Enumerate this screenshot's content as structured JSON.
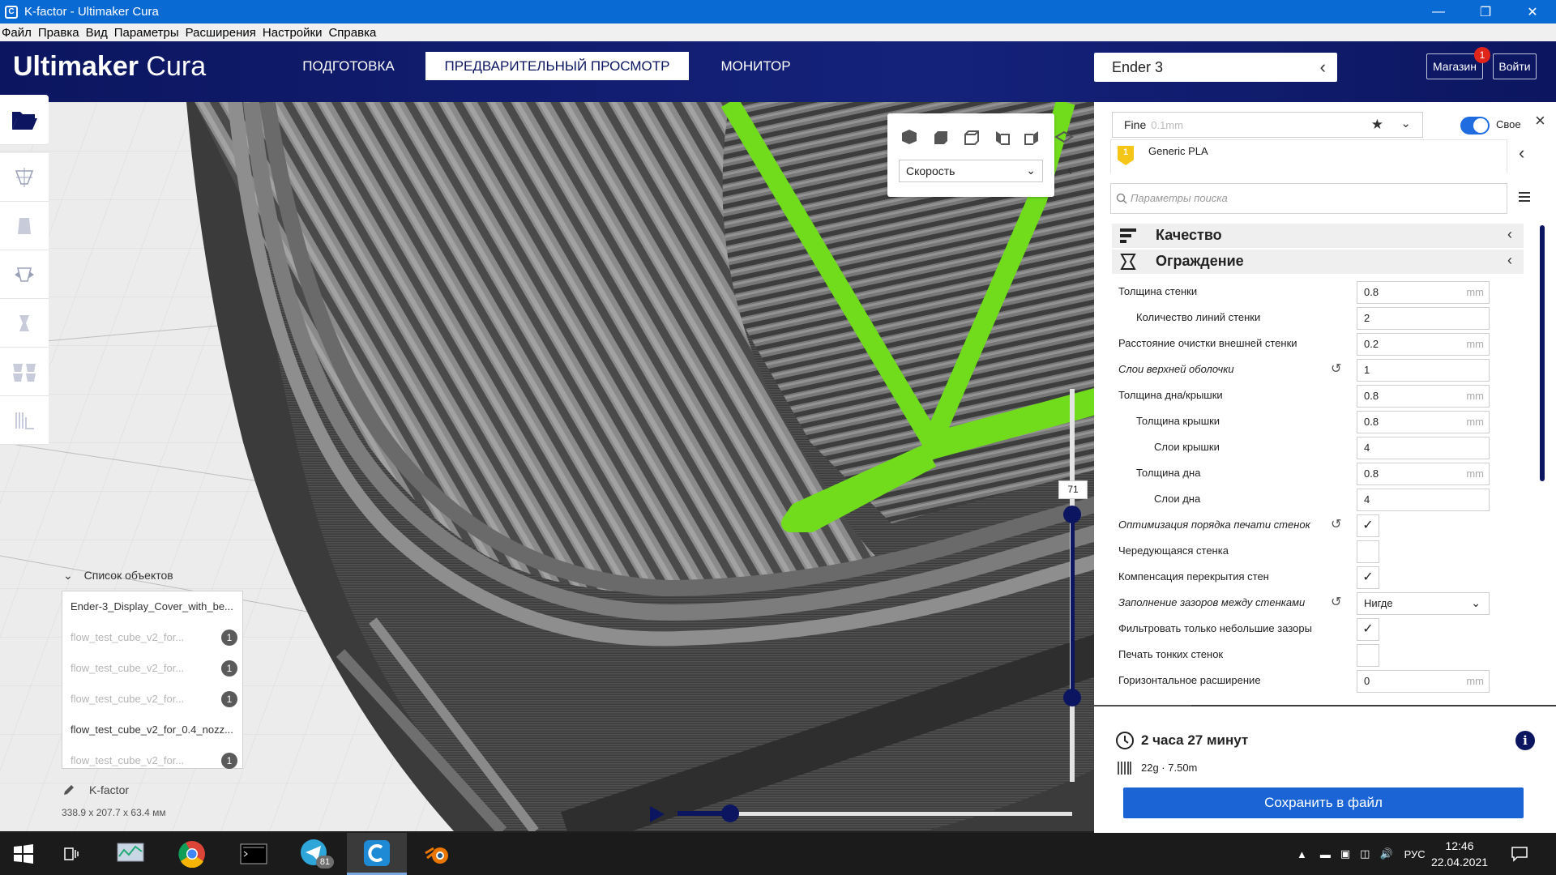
{
  "window": {
    "title": "K-factor - Ultimaker Cura",
    "app_icon": "C"
  },
  "menu": [
    "Файл",
    "Правка",
    "Вид",
    "Параметры",
    "Расширения",
    "Настройки",
    "Справка"
  ],
  "header": {
    "logo_bold": "Ultimaker",
    "logo_light": "Cura",
    "tabs": [
      {
        "label": "ПОДГОТОВКА",
        "active": false
      },
      {
        "label": "ПРЕДВАРИТЕЛЬНЫЙ ПРОСМОТР",
        "active": true
      },
      {
        "label": "МОНИТОР",
        "active": false
      }
    ],
    "printer": "Ender 3",
    "marketplace": "Магазин",
    "marketplace_badge": "1",
    "signin": "Войти"
  },
  "view_panel": {
    "color_scheme": "Скорость"
  },
  "layer_slider": {
    "current_layer": "71"
  },
  "object_list": {
    "header": "Список объектов",
    "items": [
      {
        "name": "Ender-3_Display_Cover_with_be...",
        "dim": false,
        "extruder": ""
      },
      {
        "name": "flow_test_cube_v2_for...",
        "dim": true,
        "extruder": "1"
      },
      {
        "name": "flow_test_cube_v2_for...",
        "dim": true,
        "extruder": "1"
      },
      {
        "name": "flow_test_cube_v2_for...",
        "dim": true,
        "extruder": "1"
      },
      {
        "name": "flow_test_cube_v2_for_0.4_nozz...",
        "dim": false,
        "extruder": ""
      },
      {
        "name": "flow_test_cube_v2_for...",
        "dim": true,
        "extruder": "1"
      }
    ],
    "selected_name": "K-factor",
    "dimensions": "338.9 x 207.7 x 63.4 мм"
  },
  "print_settings": {
    "profile": "Fine",
    "profile_layer": "0.1mm",
    "custom_label": "Свое",
    "material_index": "1",
    "material": "Generic PLA",
    "search_placeholder": "Параметры поиска",
    "categories": {
      "quality": "Качество",
      "shell": "Ограждение"
    },
    "settings": [
      {
        "label": "Толщина стенки",
        "value": "0.8",
        "unit": "mm",
        "indent": 0,
        "italic": false,
        "reset": false,
        "type": "number"
      },
      {
        "label": "Количество линий стенки",
        "value": "2",
        "unit": "",
        "indent": 1,
        "italic": false,
        "reset": false,
        "type": "number"
      },
      {
        "label": "Расстояние очистки внешней стенки",
        "value": "0.2",
        "unit": "mm",
        "indent": 0,
        "italic": false,
        "reset": false,
        "type": "number"
      },
      {
        "label": "Слои верхней оболочки",
        "value": "1",
        "unit": "",
        "indent": 0,
        "italic": true,
        "reset": true,
        "type": "number"
      },
      {
        "label": "Толщина дна/крышки",
        "value": "0.8",
        "unit": "mm",
        "indent": 0,
        "italic": false,
        "reset": false,
        "type": "number"
      },
      {
        "label": "Толщина крышки",
        "value": "0.8",
        "unit": "mm",
        "indent": 1,
        "italic": false,
        "reset": false,
        "type": "number"
      },
      {
        "label": "Слои крышки",
        "value": "4",
        "unit": "",
        "indent": 2,
        "italic": false,
        "reset": false,
        "type": "number"
      },
      {
        "label": "Толщина дна",
        "value": "0.8",
        "unit": "mm",
        "indent": 1,
        "italic": false,
        "reset": false,
        "type": "number"
      },
      {
        "label": "Слои дна",
        "value": "4",
        "unit": "",
        "indent": 2,
        "italic": false,
        "reset": false,
        "type": "number"
      },
      {
        "label": "Оптимизация порядка печати стенок",
        "value": "✓",
        "unit": "",
        "indent": 0,
        "italic": true,
        "reset": true,
        "type": "checkbox"
      },
      {
        "label": "Чередующаяся стенка",
        "value": "",
        "unit": "",
        "indent": 0,
        "italic": false,
        "reset": false,
        "type": "checkbox"
      },
      {
        "label": "Компенсация перекрытия стен",
        "value": "✓",
        "unit": "",
        "indent": 0,
        "italic": false,
        "reset": false,
        "type": "checkbox"
      },
      {
        "label": "Заполнение зазоров между стенками",
        "value": "Нигде",
        "unit": "",
        "indent": 0,
        "italic": true,
        "reset": true,
        "type": "dropdown"
      },
      {
        "label": "Фильтровать только небольшие зазоры",
        "value": "✓",
        "unit": "",
        "indent": 0,
        "italic": false,
        "reset": false,
        "type": "checkbox"
      },
      {
        "label": "Печать тонких стенок",
        "value": "",
        "unit": "",
        "indent": 0,
        "italic": false,
        "reset": false,
        "type": "checkbox"
      },
      {
        "label": "Горизонтальное расширение",
        "value": "0",
        "unit": "mm",
        "indent": 0,
        "italic": false,
        "reset": false,
        "type": "number"
      }
    ]
  },
  "action_panel": {
    "print_time": "2 часа 27 минут",
    "material_usage": "22g · 7.50m",
    "save_button": "Сохранить в файл"
  },
  "taskbar": {
    "telegram_badge": "81",
    "language": "РУС",
    "time": "12:46",
    "date": "22.04.2021"
  },
  "colors": {
    "brand_dark": "#0c1660",
    "accent_blue": "#1a64d6",
    "travel_green": "#70dc1c",
    "titlebar": "#0a6ad4"
  }
}
